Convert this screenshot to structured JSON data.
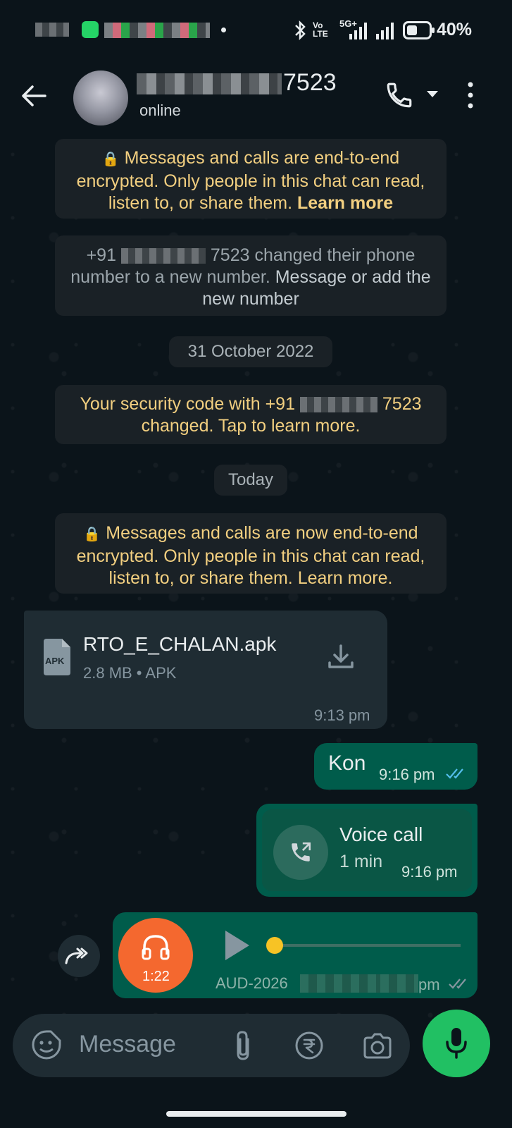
{
  "status_bar": {
    "battery": "40%",
    "network": "5G+",
    "carrier_tag": "Vo LTE"
  },
  "header": {
    "contact_suffix": "7523",
    "status": "online"
  },
  "messages": {
    "encryption_notice_1": "Messages and calls are end-to-end encrypted. Only people in this chat can read, listen to, or share them.",
    "encryption_notice_1_link": "Learn more",
    "number_change_prefix": "+91",
    "number_change_suffix": "7523 changed their phone number to a new number.",
    "number_change_link": "Message or add the new number",
    "date_chip_1": "31 October 2022",
    "security_code_prefix": "Your security code with +91",
    "security_code_suffix": "7523",
    "security_code_tail": "changed. Tap to learn more.",
    "date_chip_2": "Today",
    "encryption_notice_2": "Messages and calls are now end-to-end encrypted. Only people in this chat can read, listen to, or share them. Learn more."
  },
  "file_message": {
    "file_name": "RTO_E_CHALAN.apk",
    "file_icon_label": "APK",
    "meta": "2.8 MB • APK",
    "time": "9:13 pm"
  },
  "text_message": {
    "text": "Kon",
    "time": "9:16 pm"
  },
  "call_message": {
    "title": "Voice call",
    "duration": "1 min",
    "time": "9:16 pm"
  },
  "audio_message": {
    "duration": "1:22",
    "filename_prefix": "AUD-2026",
    "time_suffix": "pm",
    "progress": 0.0
  },
  "input_bar": {
    "placeholder": "Message"
  },
  "colors": {
    "accent_green": "#21c063",
    "bubble_out": "#005c4b",
    "bubble_in": "#1f2c33",
    "audio_orange": "#f4682f",
    "read_ticks": "#53bdeb",
    "system_yellow": "#f2cf80"
  }
}
